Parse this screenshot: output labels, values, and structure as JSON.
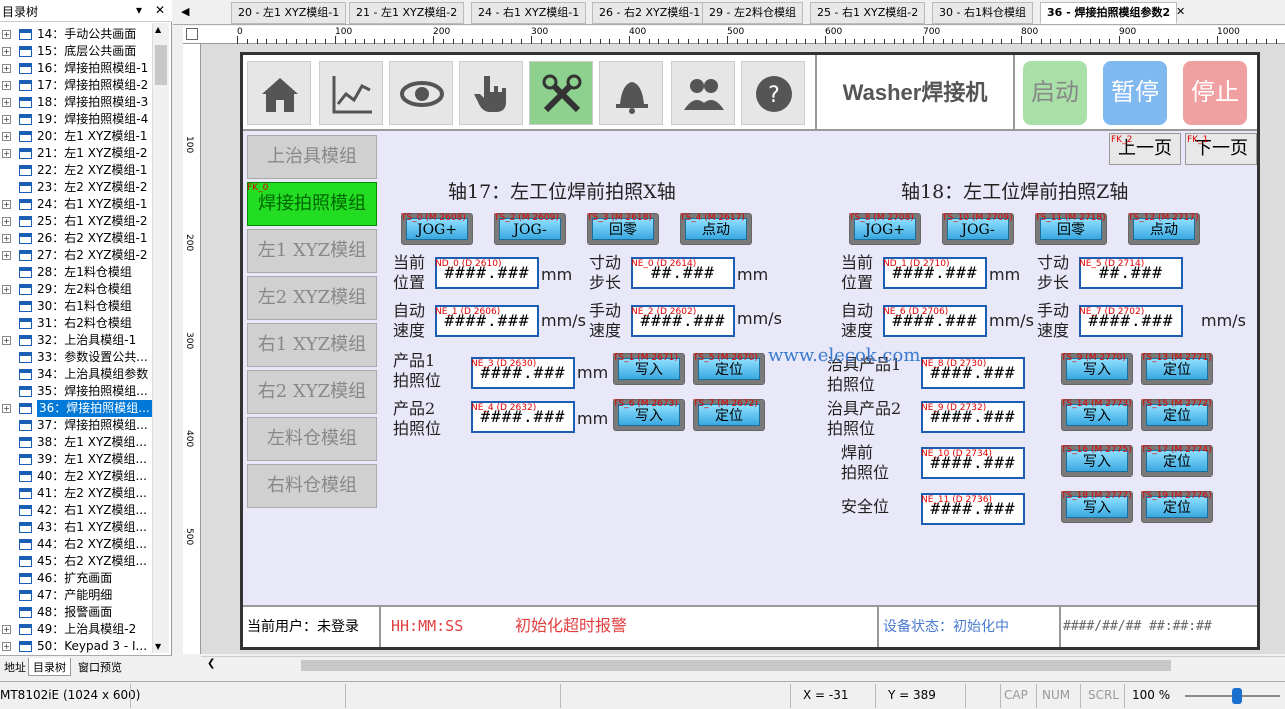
{
  "tree": {
    "title": "目录树",
    "items": [
      {
        "label": "14：手动公共画面",
        "plus": true
      },
      {
        "label": "15：底层公共画面",
        "plus": true
      },
      {
        "label": "16：焊接拍照模组-1",
        "plus": true
      },
      {
        "label": "17：焊接拍照模组-2",
        "plus": true
      },
      {
        "label": "18：焊接拍照模组-3",
        "plus": true
      },
      {
        "label": "19：焊接拍照模组-4",
        "plus": true
      },
      {
        "label": "20：左1 XYZ模组-1",
        "plus": true
      },
      {
        "label": "21：左1 XYZ模组-2",
        "plus": true
      },
      {
        "label": "22：左2 XYZ模组-1",
        "plus": false
      },
      {
        "label": "23：左2 XYZ模组-2",
        "plus": false
      },
      {
        "label": "24：右1 XYZ模组-1",
        "plus": true
      },
      {
        "label": "25：右1 XYZ模组-2",
        "plus": true
      },
      {
        "label": "26：右2 XYZ模组-1",
        "plus": true
      },
      {
        "label": "27：右2 XYZ模组-2",
        "plus": true
      },
      {
        "label": "28：左1料仓模组",
        "plus": false
      },
      {
        "label": "29：左2料仓模组",
        "plus": true
      },
      {
        "label": "30：右1料仓模组",
        "plus": false
      },
      {
        "label": "31：右2料仓模组",
        "plus": false
      },
      {
        "label": "32：上治具模组-1",
        "plus": true
      },
      {
        "label": "33：参数设置公共...",
        "plus": false
      },
      {
        "label": "34：上治具模组参数",
        "plus": false
      },
      {
        "label": "35：焊接拍照模组...",
        "plus": false
      },
      {
        "label": "36：焊接拍照模组...",
        "plus": true,
        "selected": true
      },
      {
        "label": "37：焊接拍照模组...",
        "plus": false
      },
      {
        "label": "38：左1 XYZ模组...",
        "plus": false
      },
      {
        "label": "39：左1 XYZ模组...",
        "plus": false
      },
      {
        "label": "40：左2 XYZ模组...",
        "plus": false
      },
      {
        "label": "41：左2 XYZ模组...",
        "plus": false
      },
      {
        "label": "42：右1 XYZ模组...",
        "plus": false
      },
      {
        "label": "43：右1 XYZ模组...",
        "plus": false
      },
      {
        "label": "44：右2 XYZ模组...",
        "plus": false
      },
      {
        "label": "45：右2 XYZ模组...",
        "plus": false
      },
      {
        "label": "46：扩充画面",
        "plus": false
      },
      {
        "label": "47：产能明细",
        "plus": false
      },
      {
        "label": "48：报警画面",
        "plus": false
      },
      {
        "label": "49：上治具模组-2",
        "plus": true
      },
      {
        "label": "50：Keypad 3 - I...",
        "plus": true
      }
    ],
    "bottom_tabs": [
      "地址",
      "目录树",
      "窗口预览"
    ]
  },
  "tabs": [
    "20 - 左1 XYZ模组-1",
    "21 - 左1 XYZ模组-2",
    "24 - 右1 XYZ模组-1",
    "26 - 右2 XYZ模组-1",
    "29 - 左2料仓模组",
    "25 - 右1 XYZ模组-2",
    "30 - 右1料仓模组",
    "36 - 焊接拍照模组参数2"
  ],
  "ruler_labels": [
    "0",
    "100",
    "200",
    "300",
    "400",
    "500",
    "600",
    "700",
    "800",
    "900",
    "1000"
  ],
  "ruler_v_labels": [
    "100",
    "200",
    "300",
    "400",
    "500"
  ],
  "screen": {
    "brand": "Washer焊接机",
    "start": "启动",
    "pause": "暂停",
    "stop": "停止",
    "nav": [
      "上治具模组",
      "焊接拍照模组",
      "左1 XYZ模组",
      "左2 XYZ模组",
      "右1 XYZ模组",
      "右2 XYZ模组",
      "左料仓模组",
      "右料仓模组"
    ],
    "nav_tag": "FK_0",
    "prev_page": "上一页",
    "next_page": "下一页",
    "prev_tag": "FK_2",
    "next_tag": "FK_1",
    "axis17": "轴17：左工位焊前拍照X轴",
    "axis18": "轴18：左工位焊前拍照Z轴",
    "btn_jog_plus": "JOG+",
    "btn_jog_minus": "JOG-",
    "btn_home": "回零",
    "btn_step": "点动",
    "btn_write": "写入",
    "btn_locate": "定位",
    "field_val": "####.###",
    "field_step": "##.###",
    "unit_mm": "mm",
    "unit_mms": "mm/s",
    "cur_pos": "当前\n位置",
    "jog_step": "寸动\n步长",
    "auto_speed": "自动\n速度",
    "manual_speed": "手动\n速度",
    "prod1": "产品1\n拍照位",
    "prod2": "产品2\n拍照位",
    "fix_prod1": "治具产品1\n拍照位",
    "fix_prod2": "治具产品2\n拍照位",
    "weld_pre": "焊前\n拍照位",
    "safe_pos": "安全位",
    "tags_left": [
      "TS_0 (M 2608)",
      "TS_2 (M 2609)",
      "TS_3 (M 2618)",
      "TS_4 (M 2617)",
      "ND_0 (D 2610)",
      "NE_0 (D 2614)",
      "NE_1 (D 2606)",
      "NE_2 (D 2602)",
      "NE_3 (D 2630)",
      "NE_4 (D 2632)",
      "TS_1 (M 2671)",
      "TS_5 (M 2670)",
      "TS_6 (M 2673)",
      "TS_7 (M 2672)"
    ],
    "tags_right": [
      "TS_8 (M 2708)",
      "TS_10 (M 2709)",
      "TS_11 (M 2718)",
      "TS_12 (M 2717)",
      "ND_1 (D 2710)",
      "NE_5 (D 2714)",
      "NE_6 (D 2706)",
      "NE_7 (D 2702)",
      "NE_8 (D 2730)",
      "NE_9 (D 2732)",
      "NE_10 (D 2734)",
      "NE_11 (D 2736)",
      "TS_9 (M 2770)",
      "TS_13 (M 2771)",
      "TS_14 (M 2773)",
      "TS_15 (M 2772)",
      "TS_16 (M 2775)",
      "TS_17 (M 2774)",
      "TS_18 (M 2777)",
      "TS_19 (M 2776)"
    ],
    "bottom_user": "当前用户：未登录",
    "bottom_time": "HH:MM:SS",
    "bottom_alarm": "初始化超时报警",
    "bottom_status": "设备状态：初始化中",
    "bottom_datetime": "####/##/## ##:##:##",
    "watermark": "www.elecok.com"
  },
  "status": {
    "device": "MT8102iE (1024 x 600)",
    "x": "X = -31",
    "y": "Y = 389",
    "cap": "CAP",
    "num": "NUM",
    "scrl": "SCRL",
    "zoom": "100 %"
  }
}
